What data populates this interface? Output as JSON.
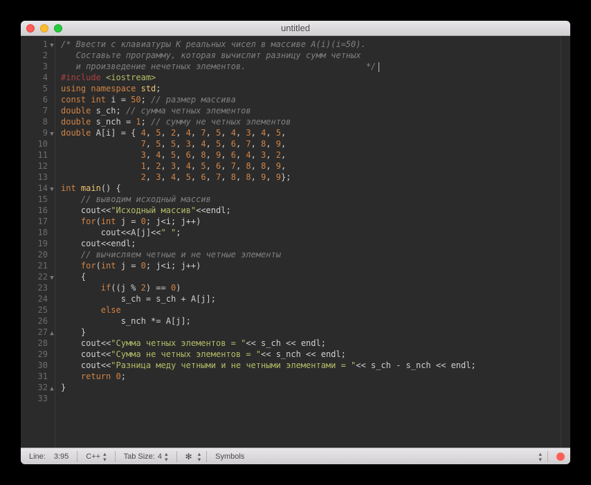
{
  "title": "untitled",
  "lines": [
    {
      "n": "1",
      "fold": "▼",
      "tokens": [
        {
          "c": "comment",
          "t": "/* Ввести с клавиатуры K реальных чисел в массиве A(i)(i=50)."
        }
      ]
    },
    {
      "n": "2",
      "tokens": [
        {
          "c": "comment",
          "t": "   Составьте программу, которая вычислит разницу сумм четных"
        }
      ]
    },
    {
      "n": "3",
      "tokens": [
        {
          "c": "comment",
          "t": "   и произведение нечетных элементов.                        */"
        }
      ],
      "cursor": true
    },
    {
      "n": "4",
      "tokens": [
        {
          "c": "pp",
          "t": "#include "
        },
        {
          "c": "ppinc",
          "t": "<iostream>"
        }
      ]
    },
    {
      "n": "5",
      "tokens": [
        {
          "c": "keyword",
          "t": "using "
        },
        {
          "c": "keyword",
          "t": "namespace "
        },
        {
          "c": "namespace",
          "t": "std"
        },
        {
          "c": "op",
          "t": ";"
        }
      ]
    },
    {
      "n": "6",
      "tokens": [
        {
          "c": "keyword",
          "t": "const "
        },
        {
          "c": "type",
          "t": "int "
        },
        {
          "c": "ident",
          "t": "i "
        },
        {
          "c": "op",
          "t": "= "
        },
        {
          "c": "number",
          "t": "50"
        },
        {
          "c": "op",
          "t": ";"
        },
        {
          "c": "comment",
          "t": " // размер массива"
        }
      ]
    },
    {
      "n": "7",
      "tokens": [
        {
          "c": "type",
          "t": "double "
        },
        {
          "c": "ident",
          "t": "s_ch"
        },
        {
          "c": "op",
          "t": ";"
        },
        {
          "c": "comment",
          "t": " // сумма четных элементов"
        }
      ]
    },
    {
      "n": "8",
      "tokens": [
        {
          "c": "type",
          "t": "double "
        },
        {
          "c": "ident",
          "t": "s_nch "
        },
        {
          "c": "op",
          "t": "= "
        },
        {
          "c": "number",
          "t": "1"
        },
        {
          "c": "op",
          "t": ";"
        },
        {
          "c": "comment",
          "t": " // сумму не четных элементов"
        }
      ]
    },
    {
      "n": "9",
      "fold": "▼",
      "tokens": [
        {
          "c": "type",
          "t": "double "
        },
        {
          "c": "ident",
          "t": "A[i] "
        },
        {
          "c": "op",
          "t": "= { "
        },
        {
          "c": "number",
          "t": "4"
        },
        {
          "c": "op",
          "t": ", "
        },
        {
          "c": "number",
          "t": "5"
        },
        {
          "c": "op",
          "t": ", "
        },
        {
          "c": "number",
          "t": "2"
        },
        {
          "c": "op",
          "t": ", "
        },
        {
          "c": "number",
          "t": "4"
        },
        {
          "c": "op",
          "t": ", "
        },
        {
          "c": "number",
          "t": "7"
        },
        {
          "c": "op",
          "t": ", "
        },
        {
          "c": "number",
          "t": "5"
        },
        {
          "c": "op",
          "t": ", "
        },
        {
          "c": "number",
          "t": "4"
        },
        {
          "c": "op",
          "t": ", "
        },
        {
          "c": "number",
          "t": "3"
        },
        {
          "c": "op",
          "t": ", "
        },
        {
          "c": "number",
          "t": "4"
        },
        {
          "c": "op",
          "t": ", "
        },
        {
          "c": "number",
          "t": "5"
        },
        {
          "c": "op",
          "t": ","
        }
      ]
    },
    {
      "n": "10",
      "tokens": [
        {
          "c": "op",
          "t": "                "
        },
        {
          "c": "number",
          "t": "7"
        },
        {
          "c": "op",
          "t": ", "
        },
        {
          "c": "number",
          "t": "5"
        },
        {
          "c": "op",
          "t": ", "
        },
        {
          "c": "number",
          "t": "5"
        },
        {
          "c": "op",
          "t": ", "
        },
        {
          "c": "number",
          "t": "3"
        },
        {
          "c": "op",
          "t": ", "
        },
        {
          "c": "number",
          "t": "4"
        },
        {
          "c": "op",
          "t": ", "
        },
        {
          "c": "number",
          "t": "5"
        },
        {
          "c": "op",
          "t": ", "
        },
        {
          "c": "number",
          "t": "6"
        },
        {
          "c": "op",
          "t": ", "
        },
        {
          "c": "number",
          "t": "7"
        },
        {
          "c": "op",
          "t": ", "
        },
        {
          "c": "number",
          "t": "8"
        },
        {
          "c": "op",
          "t": ", "
        },
        {
          "c": "number",
          "t": "9"
        },
        {
          "c": "op",
          "t": ","
        }
      ]
    },
    {
      "n": "11",
      "tokens": [
        {
          "c": "op",
          "t": "                "
        },
        {
          "c": "number",
          "t": "3"
        },
        {
          "c": "op",
          "t": ", "
        },
        {
          "c": "number",
          "t": "4"
        },
        {
          "c": "op",
          "t": ", "
        },
        {
          "c": "number",
          "t": "5"
        },
        {
          "c": "op",
          "t": ", "
        },
        {
          "c": "number",
          "t": "6"
        },
        {
          "c": "op",
          "t": ", "
        },
        {
          "c": "number",
          "t": "8"
        },
        {
          "c": "op",
          "t": ", "
        },
        {
          "c": "number",
          "t": "9"
        },
        {
          "c": "op",
          "t": ", "
        },
        {
          "c": "number",
          "t": "6"
        },
        {
          "c": "op",
          "t": ", "
        },
        {
          "c": "number",
          "t": "4"
        },
        {
          "c": "op",
          "t": ", "
        },
        {
          "c": "number",
          "t": "3"
        },
        {
          "c": "op",
          "t": ", "
        },
        {
          "c": "number",
          "t": "2"
        },
        {
          "c": "op",
          "t": ","
        }
      ]
    },
    {
      "n": "12",
      "tokens": [
        {
          "c": "op",
          "t": "                "
        },
        {
          "c": "number",
          "t": "1"
        },
        {
          "c": "op",
          "t": ", "
        },
        {
          "c": "number",
          "t": "2"
        },
        {
          "c": "op",
          "t": ", "
        },
        {
          "c": "number",
          "t": "3"
        },
        {
          "c": "op",
          "t": ", "
        },
        {
          "c": "number",
          "t": "4"
        },
        {
          "c": "op",
          "t": ", "
        },
        {
          "c": "number",
          "t": "5"
        },
        {
          "c": "op",
          "t": ", "
        },
        {
          "c": "number",
          "t": "6"
        },
        {
          "c": "op",
          "t": ", "
        },
        {
          "c": "number",
          "t": "7"
        },
        {
          "c": "op",
          "t": ", "
        },
        {
          "c": "number",
          "t": "8"
        },
        {
          "c": "op",
          "t": ", "
        },
        {
          "c": "number",
          "t": "8"
        },
        {
          "c": "op",
          "t": ", "
        },
        {
          "c": "number",
          "t": "9"
        },
        {
          "c": "op",
          "t": ","
        }
      ]
    },
    {
      "n": "13",
      "tokens": [
        {
          "c": "op",
          "t": "                "
        },
        {
          "c": "number",
          "t": "2"
        },
        {
          "c": "op",
          "t": ", "
        },
        {
          "c": "number",
          "t": "3"
        },
        {
          "c": "op",
          "t": ", "
        },
        {
          "c": "number",
          "t": "4"
        },
        {
          "c": "op",
          "t": ", "
        },
        {
          "c": "number",
          "t": "5"
        },
        {
          "c": "op",
          "t": ", "
        },
        {
          "c": "number",
          "t": "6"
        },
        {
          "c": "op",
          "t": ", "
        },
        {
          "c": "number",
          "t": "7"
        },
        {
          "c": "op",
          "t": ", "
        },
        {
          "c": "number",
          "t": "8"
        },
        {
          "c": "op",
          "t": ", "
        },
        {
          "c": "number",
          "t": "8"
        },
        {
          "c": "op",
          "t": ", "
        },
        {
          "c": "number",
          "t": "9"
        },
        {
          "c": "op",
          "t": ", "
        },
        {
          "c": "number",
          "t": "9"
        },
        {
          "c": "op",
          "t": "};"
        }
      ]
    },
    {
      "n": "14",
      "fold": "▼",
      "mark": "●",
      "tokens": [
        {
          "c": "type",
          "t": "int "
        },
        {
          "c": "func",
          "t": "main"
        },
        {
          "c": "op",
          "t": "() {"
        }
      ]
    },
    {
      "n": "15",
      "tokens": [
        {
          "c": "op",
          "t": "    "
        },
        {
          "c": "comment",
          "t": "// выводим исходный массив"
        }
      ]
    },
    {
      "n": "16",
      "tokens": [
        {
          "c": "op",
          "t": "    "
        },
        {
          "c": "ident",
          "t": "cout"
        },
        {
          "c": "op",
          "t": "<<"
        },
        {
          "c": "string",
          "t": "\"Исходный массив\""
        },
        {
          "c": "op",
          "t": "<<"
        },
        {
          "c": "ident",
          "t": "endl"
        },
        {
          "c": "op",
          "t": ";"
        }
      ]
    },
    {
      "n": "17",
      "tokens": [
        {
          "c": "op",
          "t": "    "
        },
        {
          "c": "keyword",
          "t": "for"
        },
        {
          "c": "op",
          "t": "("
        },
        {
          "c": "type",
          "t": "int "
        },
        {
          "c": "ident",
          "t": "j "
        },
        {
          "c": "op",
          "t": "= "
        },
        {
          "c": "number",
          "t": "0"
        },
        {
          "c": "op",
          "t": "; j<i; j++)"
        }
      ]
    },
    {
      "n": "18",
      "tokens": [
        {
          "c": "op",
          "t": "        "
        },
        {
          "c": "ident",
          "t": "cout"
        },
        {
          "c": "op",
          "t": "<<A[j]<<"
        },
        {
          "c": "string",
          "t": "\" \""
        },
        {
          "c": "op",
          "t": ";"
        }
      ]
    },
    {
      "n": "19",
      "tokens": [
        {
          "c": "op",
          "t": "    "
        },
        {
          "c": "ident",
          "t": "cout"
        },
        {
          "c": "op",
          "t": "<<"
        },
        {
          "c": "ident",
          "t": "endl"
        },
        {
          "c": "op",
          "t": ";"
        }
      ]
    },
    {
      "n": "20",
      "tokens": [
        {
          "c": "op",
          "t": "    "
        },
        {
          "c": "comment",
          "t": "// вычисляем четные и не четные элементы"
        }
      ]
    },
    {
      "n": "21",
      "tokens": [
        {
          "c": "op",
          "t": "    "
        },
        {
          "c": "keyword",
          "t": "for"
        },
        {
          "c": "op",
          "t": "("
        },
        {
          "c": "type",
          "t": "int "
        },
        {
          "c": "ident",
          "t": "j "
        },
        {
          "c": "op",
          "t": "= "
        },
        {
          "c": "number",
          "t": "0"
        },
        {
          "c": "op",
          "t": "; j<i; j++)"
        }
      ]
    },
    {
      "n": "22",
      "fold": "▼",
      "tokens": [
        {
          "c": "op",
          "t": "    {"
        }
      ]
    },
    {
      "n": "23",
      "tokens": [
        {
          "c": "op",
          "t": "        "
        },
        {
          "c": "keyword",
          "t": "if"
        },
        {
          "c": "op",
          "t": "((j % "
        },
        {
          "c": "number",
          "t": "2"
        },
        {
          "c": "op",
          "t": ") == "
        },
        {
          "c": "number",
          "t": "0"
        },
        {
          "c": "op",
          "t": ")"
        }
      ]
    },
    {
      "n": "24",
      "tokens": [
        {
          "c": "op",
          "t": "            s_ch = s_ch + A[j];"
        }
      ]
    },
    {
      "n": "25",
      "tokens": [
        {
          "c": "op",
          "t": "        "
        },
        {
          "c": "keyword",
          "t": "else"
        }
      ]
    },
    {
      "n": "26",
      "tokens": [
        {
          "c": "op",
          "t": "            s_nch *= A[j];"
        }
      ]
    },
    {
      "n": "27",
      "fold": "▲",
      "tokens": [
        {
          "c": "op",
          "t": "    }"
        }
      ]
    },
    {
      "n": "28",
      "tokens": [
        {
          "c": "op",
          "t": "    "
        },
        {
          "c": "ident",
          "t": "cout"
        },
        {
          "c": "op",
          "t": "<<"
        },
        {
          "c": "string",
          "t": "\"Сумма четных элементов = \""
        },
        {
          "c": "op",
          "t": "<< s_ch << "
        },
        {
          "c": "ident",
          "t": "endl"
        },
        {
          "c": "op",
          "t": ";"
        }
      ]
    },
    {
      "n": "29",
      "tokens": [
        {
          "c": "op",
          "t": "    "
        },
        {
          "c": "ident",
          "t": "cout"
        },
        {
          "c": "op",
          "t": "<<"
        },
        {
          "c": "string",
          "t": "\"Сумма не четных элементов = \""
        },
        {
          "c": "op",
          "t": "<< s_nch << "
        },
        {
          "c": "ident",
          "t": "endl"
        },
        {
          "c": "op",
          "t": ";"
        }
      ]
    },
    {
      "n": "30",
      "tokens": [
        {
          "c": "op",
          "t": "    "
        },
        {
          "c": "ident",
          "t": "cout"
        },
        {
          "c": "op",
          "t": "<<"
        },
        {
          "c": "string",
          "t": "\"Разница меду четными и не четными элементами = \""
        },
        {
          "c": "op",
          "t": "<< s_ch - s_nch << "
        },
        {
          "c": "ident",
          "t": "endl"
        },
        {
          "c": "op",
          "t": ";"
        }
      ]
    },
    {
      "n": "31",
      "tokens": [
        {
          "c": "op",
          "t": "    "
        },
        {
          "c": "keyword",
          "t": "return "
        },
        {
          "c": "number",
          "t": "0"
        },
        {
          "c": "op",
          "t": ";"
        }
      ]
    },
    {
      "n": "32",
      "fold": "▲",
      "tokens": [
        {
          "c": "op",
          "t": "}"
        }
      ]
    },
    {
      "n": "33",
      "tokens": [
        {
          "c": "op",
          "t": ""
        }
      ]
    }
  ],
  "status": {
    "line_label": "Line:",
    "pos": "3:95",
    "lang": "C++",
    "tab_label": "Tab Size:",
    "tab_value": "4",
    "symbols": "Symbols"
  }
}
